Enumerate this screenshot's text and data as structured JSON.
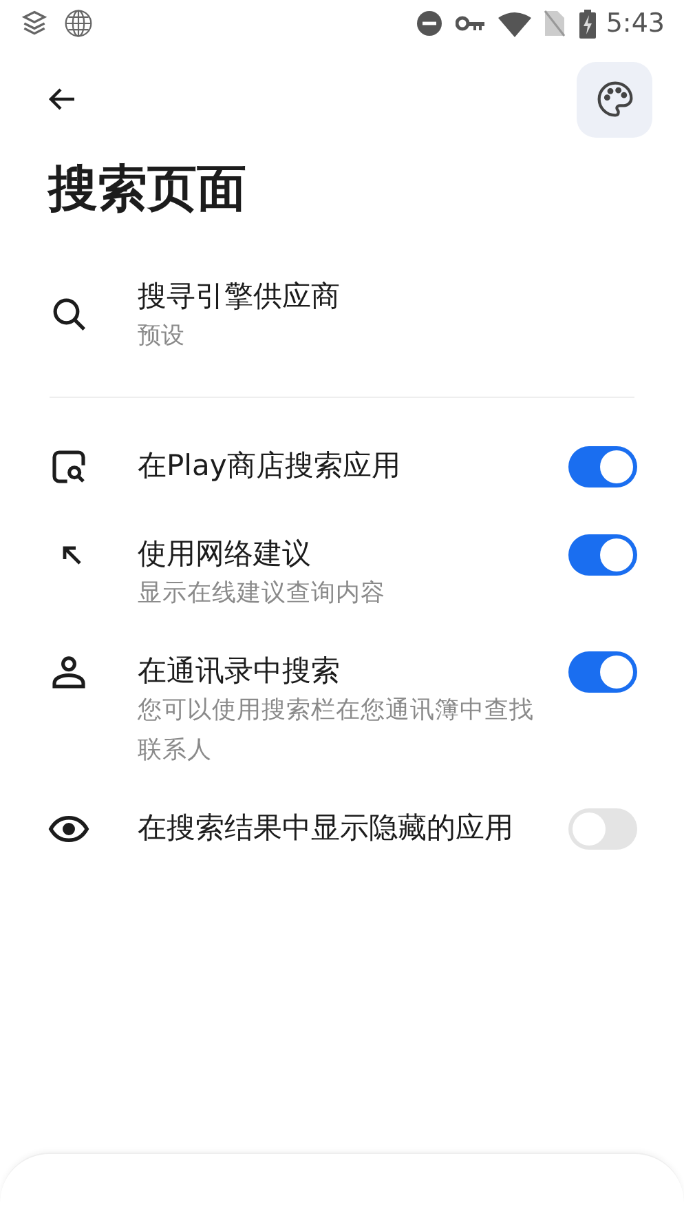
{
  "status_bar": {
    "time": "5:43"
  },
  "header": {
    "title": "搜索页面"
  },
  "provider": {
    "title": "搜寻引擎供应商",
    "subtitle": "预设"
  },
  "settings": [
    {
      "title": "在Play商店搜索应用",
      "on": true
    },
    {
      "title": "使用网络建议",
      "subtitle": "显示在线建议查询内容",
      "on": true
    },
    {
      "title": "在通讯录中搜索",
      "subtitle": "您可以使用搜索栏在您通讯簿中查找联系人",
      "on": true
    },
    {
      "title": "在搜索结果中显示隐藏的应用",
      "on": false
    }
  ]
}
